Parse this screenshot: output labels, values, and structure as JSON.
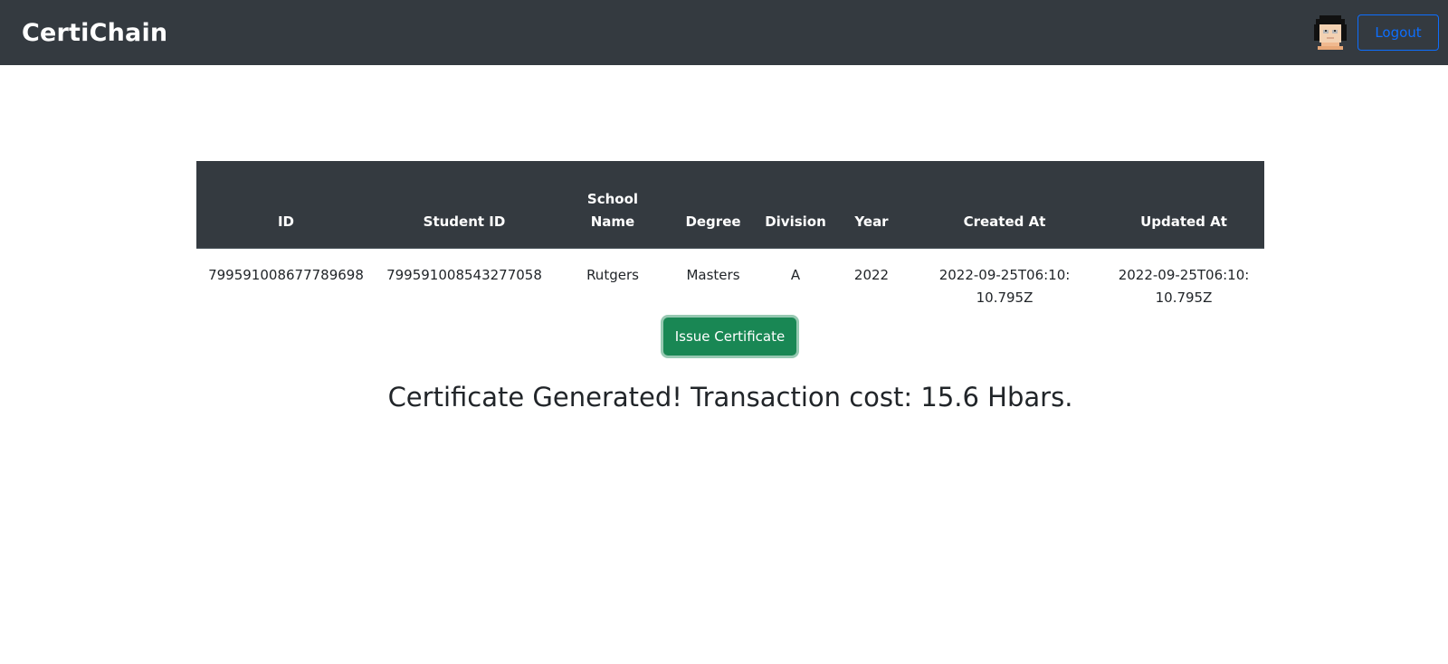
{
  "navbar": {
    "brand": "CertiChain",
    "avatar_icon": "pixel-avatar-icon",
    "logout_label": "Logout",
    "background": "#343a40",
    "logout_color": "#0d6efd"
  },
  "table": {
    "headers": {
      "id": "ID",
      "student_id": "Student ID",
      "school_name_line1": "School",
      "school_name_line2": "Name",
      "degree": "Degree",
      "division": "Division",
      "year": "Year",
      "created_at": "Created At",
      "updated_at": "Updated At"
    },
    "rows": [
      {
        "id": "799591008677789698",
        "student_id": "799591008543277058",
        "school_name": "Rutgers",
        "degree": "Masters",
        "division": "A",
        "year": "2022",
        "created_at": "2022-09-25T06:10:10.795Z",
        "updated_at": "2022-09-25T06:10:10.795Z"
      }
    ]
  },
  "actions": {
    "issue_label": "Issue Certificate",
    "issue_color": "#198754"
  },
  "status": {
    "message": "Certificate Generated! Transaction cost: 15.6 Hbars."
  }
}
